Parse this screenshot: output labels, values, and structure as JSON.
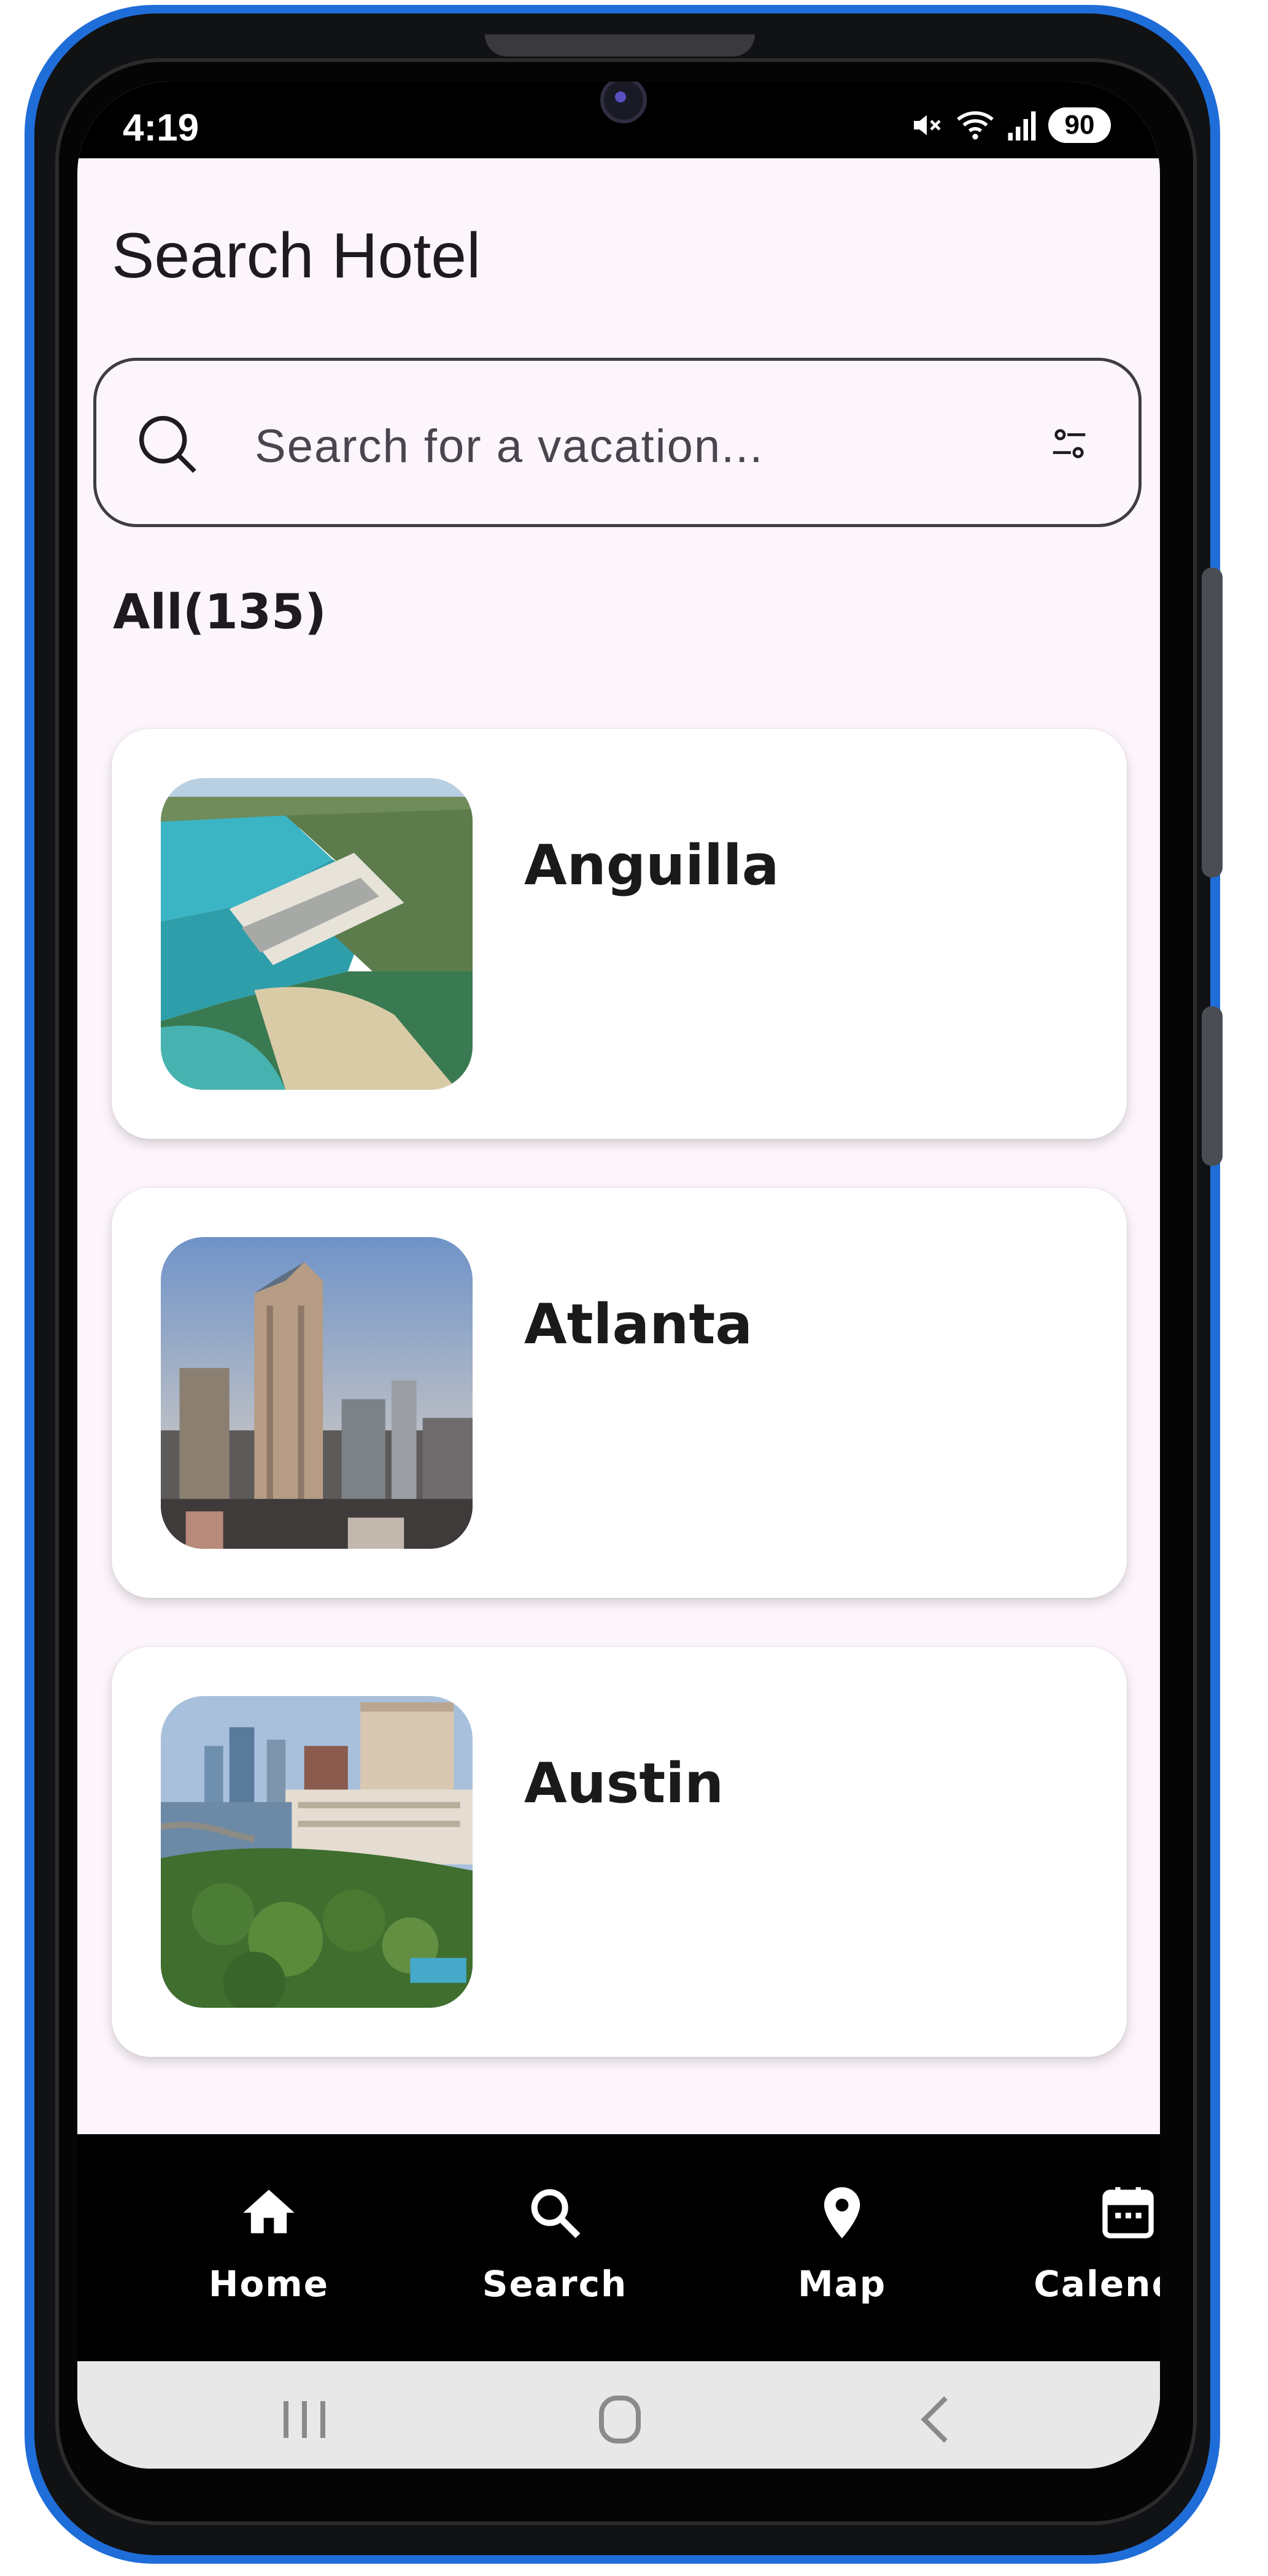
{
  "status_bar": {
    "time": "4:19",
    "battery": "90",
    "icons": [
      "mute-icon",
      "wifi-icon",
      "signal-icon"
    ]
  },
  "page": {
    "title": "Search Hotel"
  },
  "search": {
    "placeholder": "Search for a vacation...",
    "value": ""
  },
  "results": {
    "count_label": "All(135)",
    "items": [
      {
        "name": "Anguilla",
        "image": "anguilla-resort-photo"
      },
      {
        "name": "Atlanta",
        "image": "atlanta-skyline-photo"
      },
      {
        "name": "Austin",
        "image": "austin-riverside-photo"
      }
    ]
  },
  "bottom_nav": {
    "items": [
      {
        "label": "Home",
        "icon": "home-icon"
      },
      {
        "label": "Search",
        "icon": "search-icon"
      },
      {
        "label": "Map",
        "icon": "map-pin-icon"
      },
      {
        "label": "Calendar",
        "icon": "calendar-icon"
      }
    ]
  },
  "system_nav": {
    "buttons": [
      "recents-button",
      "home-button",
      "back-button"
    ]
  },
  "colors": {
    "frame": "#1f6dd8",
    "background": "#fcf5fb",
    "nav_bar": "#000000"
  }
}
